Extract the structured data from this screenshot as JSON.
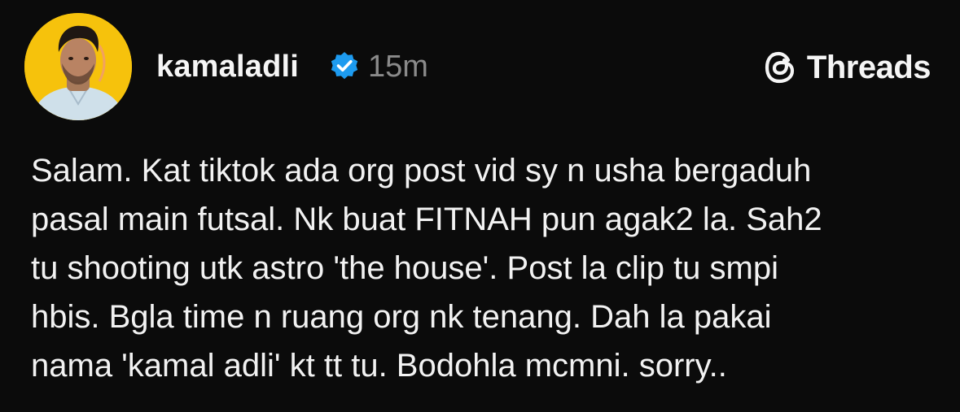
{
  "post": {
    "username": "kamaladli",
    "timestamp": "15m",
    "verified": true,
    "brand": {
      "label": "Threads",
      "icon": "threads-logo-icon"
    },
    "avatar": {
      "background": "#f6c20c"
    },
    "text_lines": [
      "Salam. Kat tiktok ada org post vid sy n usha bergaduh",
      "pasal main futsal. Nk buat FITNAH pun agak2 la. Sah2",
      "tu shooting utk astro 'the house'. Post la clip tu smpi",
      "hbis. Bgla time n ruang org nk tenang. Dah la pakai",
      "nama 'kamal adli' kt tt tu. Bodohla mcmni. sorry.."
    ]
  },
  "colors": {
    "background": "#0b0b0b",
    "text": "#f2f2f2",
    "muted": "#8a8a8a",
    "verified": "#1d9bf0"
  }
}
